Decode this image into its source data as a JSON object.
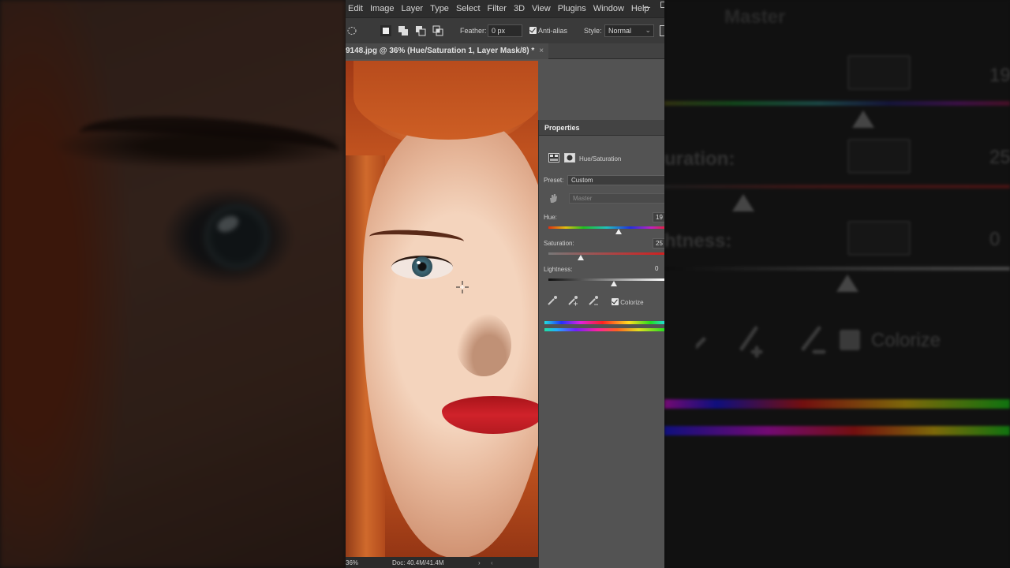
{
  "menubar": {
    "items": [
      "Edit",
      "Image",
      "Layer",
      "Type",
      "Select",
      "Filter",
      "3D",
      "View",
      "Plugins",
      "Window",
      "Help"
    ]
  },
  "options": {
    "feather_label": "Feather:",
    "feather_value": "0 px",
    "antialias_label": "Anti-alias",
    "style_label": "Style:",
    "style_value": "Normal"
  },
  "document": {
    "tab_title": "9148.jpg @ 36% (Hue/Saturation 1, Layer Mask/8) *",
    "tab_close": "×",
    "zoom": "36%",
    "doc_size": "Doc: 40.4M/41.4M"
  },
  "properties": {
    "panel_title": "Properties",
    "adjustment_name": "Hue/Saturation",
    "preset_label": "Preset:",
    "preset_value": "Custom",
    "channel_value": "Master",
    "hue_label": "Hue:",
    "hue_value": "19",
    "saturation_label": "Saturation:",
    "saturation_value": "25",
    "lightness_label": "Lightness:",
    "lightness_value": "0",
    "colorize_label": "Colorize",
    "colorize_checked": true
  },
  "zoomed_background": {
    "channel_value": "Master",
    "saturation_label": "uration:",
    "lightness_label": "htness:",
    "hue_value": "19",
    "saturation_value": "25",
    "lightness_value": "0",
    "colorize_label": "Colorize"
  },
  "colors": {
    "menubar": "#2d2d2d",
    "panel": "#535353",
    "hair": "#b5461f",
    "lips": "#c41a1e"
  }
}
